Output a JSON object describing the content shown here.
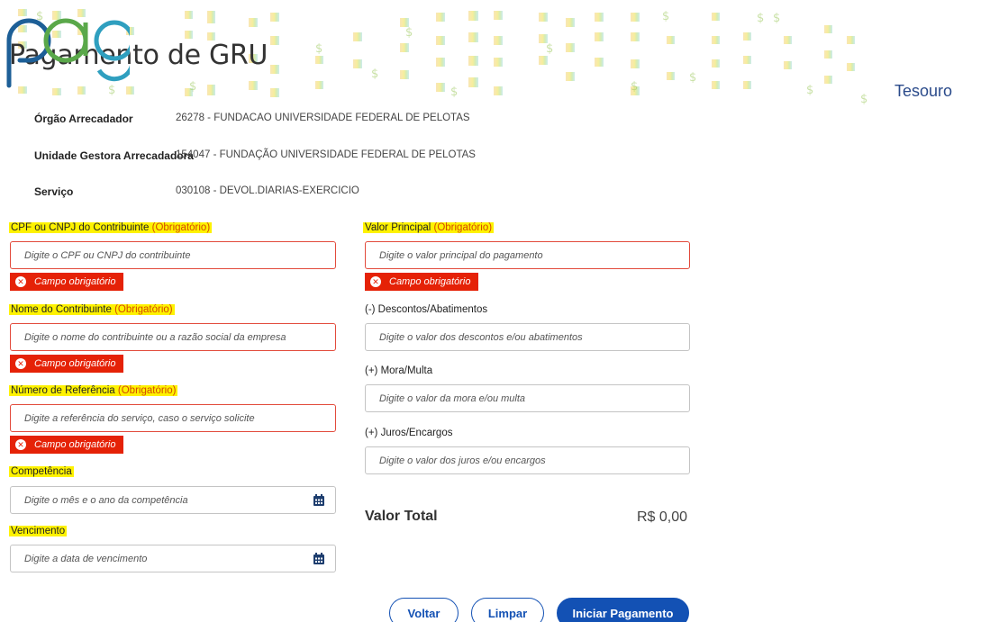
{
  "header": {
    "title": "Pagamento de GRU",
    "logo_text": "Tesouro"
  },
  "info": [
    {
      "label": "Órgão Arrecadador",
      "value": "26278 - FUNDACAO UNIVERSIDADE FEDERAL DE PELOTAS"
    },
    {
      "label": "Unidade Gestora Arrecadadora",
      "value": "154047 - FUNDAÇÃO UNIVERSIDADE FEDERAL DE PELOTAS"
    },
    {
      "label": "Serviço",
      "value": "030108 - DEVOL.DIARIAS-EXERCICIO"
    }
  ],
  "required_tag": "(Obrigatório)",
  "error_message": "Campo obrigatório",
  "left_fields": {
    "cpf": {
      "label": "CPF ou CNPJ do Contribuinte",
      "placeholder": "Digite o CPF ou CNPJ do contribuinte"
    },
    "nome": {
      "label": "Nome do Contribuinte",
      "placeholder": "Digite o nome do contribuinte ou a razão social da empresa"
    },
    "referencia": {
      "label": "Número de Referência",
      "placeholder": "Digite a referência do serviço, caso o serviço solicite"
    },
    "competencia": {
      "label": "Competência",
      "placeholder": "Digite o mês e o ano da competência"
    },
    "vencimento": {
      "label": "Vencimento",
      "placeholder": "Digite a data de vencimento"
    }
  },
  "right_fields": {
    "valor_principal": {
      "label": "Valor Principal",
      "placeholder": "Digite o valor principal do pagamento"
    },
    "descontos": {
      "label": "(-) Descontos/Abatimentos",
      "placeholder": "Digite o valor dos descontos e/ou abatimentos"
    },
    "mora": {
      "label": "(+) Mora/Multa",
      "placeholder": "Digite o valor da mora e/ou multa"
    },
    "juros": {
      "label": "(+) Juros/Encargos",
      "placeholder": "Digite o valor dos juros e/ou encargos"
    }
  },
  "total": {
    "label": "Valor Total",
    "value": "R$ 0,00"
  },
  "buttons": {
    "back": "Voltar",
    "clear": "Limpar",
    "start": "Iniciar Pagamento"
  },
  "colors": {
    "primary": "#1351b4",
    "error": "#e52207",
    "highlight": "#fef200",
    "required": "#d44a00"
  },
  "icons": {
    "calendar": "calendar-icon",
    "error": "close-circle-icon"
  }
}
